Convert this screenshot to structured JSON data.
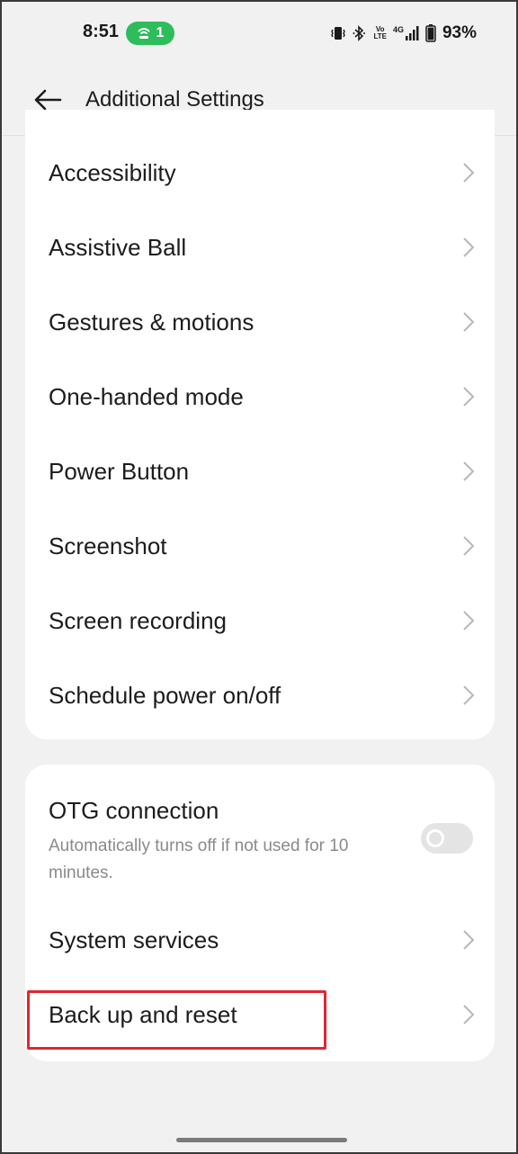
{
  "status_bar": {
    "time": "8:51",
    "hotspot_count": "1",
    "battery_percent": "93%",
    "hotspot_color": "#2dbd5a",
    "icons": [
      "hotspot-icon",
      "vibrate-icon",
      "bluetooth-icon",
      "volte-icon",
      "signal-icon",
      "battery-icon"
    ],
    "volte_top": "Vo",
    "volte_bottom": "LTE",
    "network": "4G"
  },
  "header": {
    "title": "Additional Settings",
    "back_icon": "back-arrow-icon"
  },
  "settings_group_1": [
    {
      "label": "Accessibility"
    },
    {
      "label": "Assistive Ball"
    },
    {
      "label": "Gestures & motions"
    },
    {
      "label": "One-handed mode"
    },
    {
      "label": "Power Button"
    },
    {
      "label": "Screenshot"
    },
    {
      "label": "Screen recording"
    },
    {
      "label": "Schedule power on/off"
    }
  ],
  "settings_group_2": {
    "otg": {
      "label": "OTG connection",
      "description": "Automatically turns off if not used for 10 minutes.",
      "enabled": false
    },
    "items": [
      {
        "label": "System services"
      },
      {
        "label": "Back up and reset"
      }
    ]
  },
  "highlight": {
    "target": "Back up and reset",
    "color": "#e0262f"
  }
}
